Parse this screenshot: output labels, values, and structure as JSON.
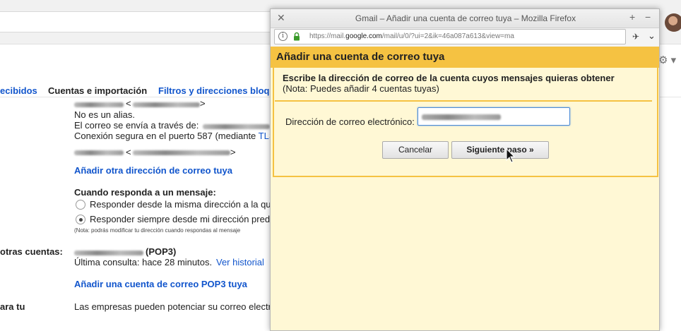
{
  "gmail": {
    "tabs": [
      {
        "label": "ecibidos"
      },
      {
        "label": "Cuentas e importación"
      },
      {
        "label": "Filtros y direcciones bloq"
      }
    ],
    "send_as": {
      "not_alias": "No es un alias.",
      "sent_via": "El correo se envía a través de:",
      "secure_conn_prefix": "Conexión segura en el puerto 587 (mediante ",
      "secure_conn_link": "TLS",
      "add_other_address": "Añadir otra dirección de correo tuya"
    },
    "reply": {
      "heading": "Cuando responda a un mensaje:",
      "option_same": "Responder desde la misma dirección a la qu",
      "option_default": "Responder siempre desde mi dirección pred",
      "note": "(Nota: podrás modificar tu dirección cuando respondas al mensaje"
    },
    "other_accounts": {
      "label": "otras cuentas:",
      "account_type": "(POP3)",
      "last_check": "Última consulta: hace 28 minutos.",
      "history_link": "Ver historial",
      "add_pop3": "Añadir una cuenta de correo POP3 tuya"
    },
    "business": {
      "label": "ara tu",
      "text": "Las empresas pueden potenciar su correo electr"
    }
  },
  "popup": {
    "window_title": "Gmail – Añadir una cuenta de correo tuya – Mozilla Firefox",
    "url_prefix": "https://mail.",
    "url_domain": "google.com",
    "url_rest": "/mail/u/0/?ui=2&ik=46a087a613&view=ma",
    "heading": "Añadir una cuenta de correo tuya",
    "description": "Escribe la dirección de correo de la cuenta cuyos mensajes quieras obtener",
    "note": "(Nota: Puedes añadir 4 cuentas tuyas)",
    "email_label": "Dirección de correo electrónico:",
    "email_value": "",
    "cancel_label": "Cancelar",
    "next_label": "Siguiente paso »"
  },
  "colors": {
    "banner": "#f5c242",
    "panel_bg": "#fff8d5",
    "link": "#1155cc"
  }
}
